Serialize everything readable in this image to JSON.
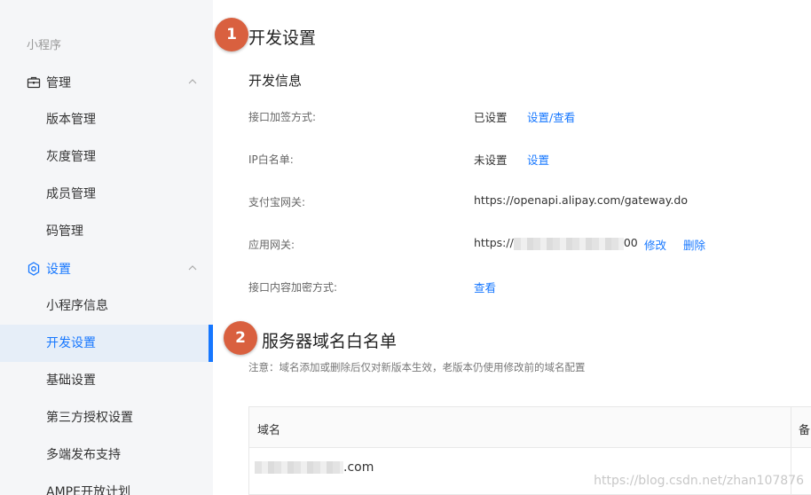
{
  "sidebar": {
    "app_label": "小程序",
    "groups": [
      {
        "label": "管理",
        "items": [
          "版本管理",
          "灰度管理",
          "成员管理",
          "码管理"
        ]
      },
      {
        "label": "设置",
        "items": [
          "小程序信息",
          "开发设置",
          "基础设置",
          "第三方授权设置",
          "多端发布支持",
          "AMPE开放计划"
        ]
      }
    ],
    "active_item": "开发设置"
  },
  "main": {
    "section1": {
      "badge": "1",
      "title": "开发设置",
      "subtitle": "开发信息"
    },
    "rows": [
      {
        "label": "接口加签方式:",
        "value": "已设置",
        "links": [
          "设置/查看"
        ]
      },
      {
        "label": "IP白名单:",
        "value": "未设置",
        "links": [
          "设置"
        ]
      },
      {
        "label": "支付宝网关:",
        "value": "https://openapi.alipay.com/gateway.do",
        "links": []
      },
      {
        "label": "应用网关:",
        "value_prefix": "https://",
        "value_suffix": "00",
        "links": [
          "修改",
          "删除"
        ]
      },
      {
        "label": "接口内容加密方式:",
        "value": "",
        "links": [
          "查看"
        ]
      }
    ],
    "section2": {
      "badge": "2",
      "title": "服务器域名白名单",
      "note": "注意：域名添加或删除后仅对新版本生效，老版本仍使用修改前的域名配置"
    },
    "table": {
      "headers": [
        "域名",
        "备"
      ],
      "rows": [
        {
          "domain_suffix": ".com"
        }
      ]
    }
  },
  "watermark": "https://blog.csdn.net/zhan107876",
  "colors": {
    "accent": "#1677ff",
    "badge": "#d9603f",
    "sidebar_bg": "#f5f6f8",
    "active_bg": "#e6eef8"
  }
}
